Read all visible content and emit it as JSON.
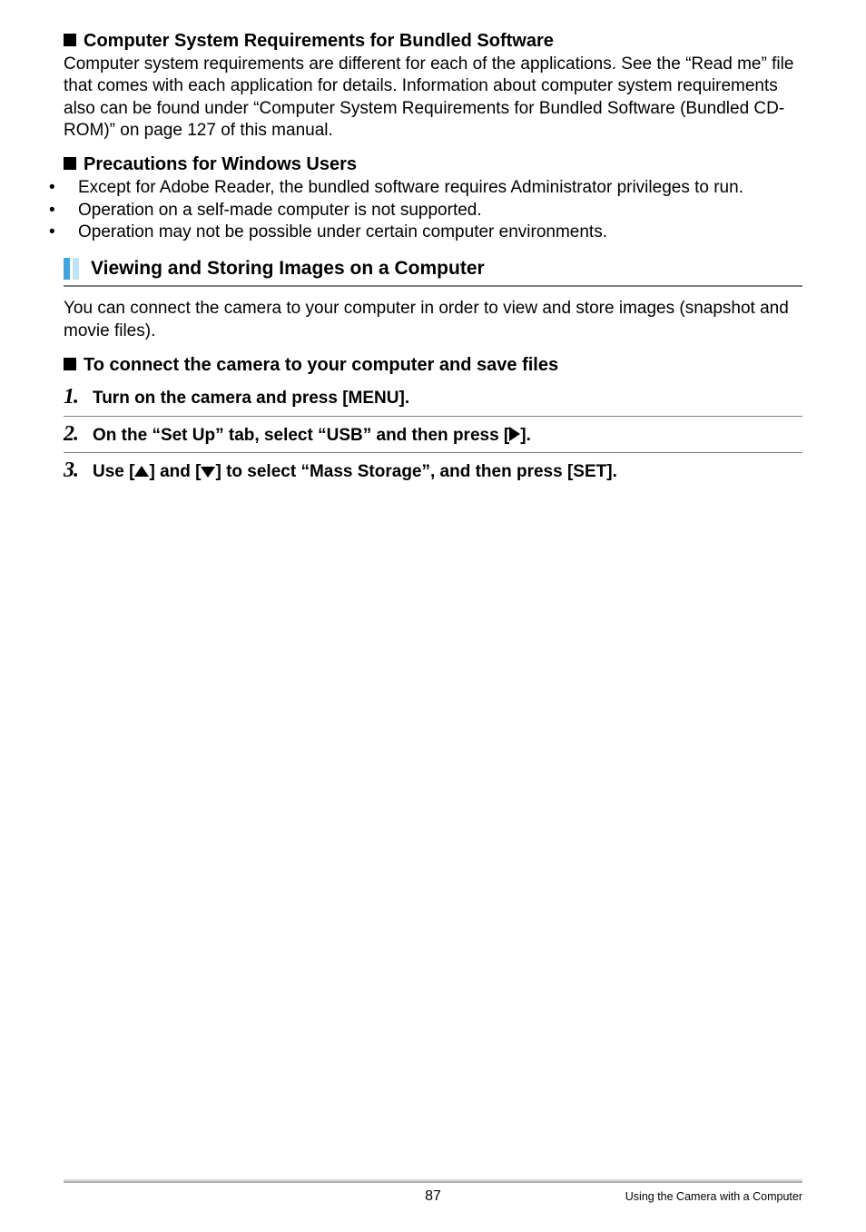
{
  "accent_colors": [
    "#3aa7e0",
    "#bfe3f4"
  ],
  "section1": {
    "heading": "Computer System Requirements for Bundled Software",
    "body": "Computer system requirements are different for each of the applications. See the “Read me” file that comes with each application for details. Information about computer system requirements also can be found under “Computer System Requirements for Bundled Software (Bundled CD-ROM)” on page 127 of this manual."
  },
  "section2": {
    "heading": "Precautions for Windows Users",
    "bullets": [
      "Except for Adobe Reader, the bundled software requires Administrator privileges to run.",
      "Operation on a self-made computer is not supported.",
      "Operation may not be possible under certain computer environments."
    ]
  },
  "section3": {
    "title": "Viewing and Storing Images on a Computer",
    "body": "You can connect the camera to your computer in order to view and store images (snapshot and movie files).",
    "subhead": "To connect the camera to your computer and save files",
    "steps": {
      "n1": "1.",
      "t1": "Turn on the camera and press [MENU].",
      "n2": "2.",
      "t2_a": "On the “Set Up” tab, select “USB” and then press [",
      "t2_b": "].",
      "n3": "3.",
      "t3_a": "Use [",
      "t3_b": "] and [",
      "t3_c": "] to select “Mass Storage”, and then press [SET]."
    }
  },
  "footer": {
    "page": "87",
    "label": "Using the Camera with a Computer"
  }
}
